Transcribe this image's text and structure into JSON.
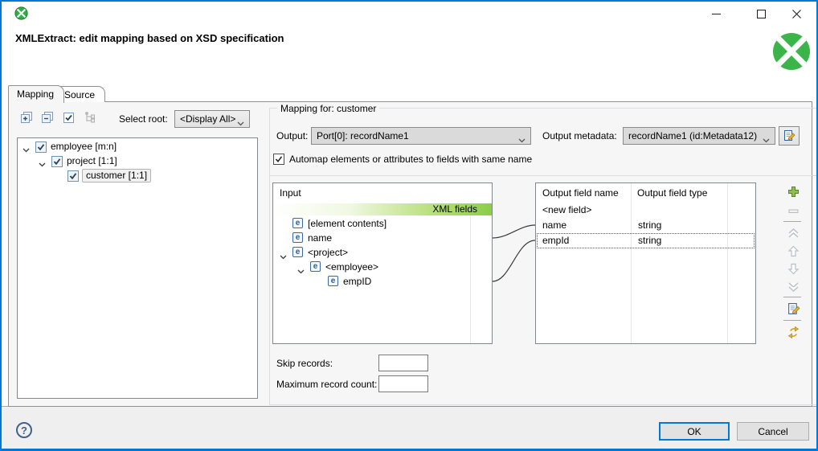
{
  "window": {
    "title": "XMLExtract: edit mapping based on XSD specification"
  },
  "tabs": [
    {
      "label": "Mapping"
    },
    {
      "label": "Source"
    }
  ],
  "left": {
    "select_root_label": "Select root:",
    "select_root_value": "<Display All>",
    "tree": [
      {
        "label": "employee [m:n]",
        "checked": true,
        "expanded": true
      },
      {
        "label": "project [1:1]",
        "checked": true,
        "expanded": true
      },
      {
        "label": "customer [1:1]",
        "checked": true,
        "selected": true
      }
    ]
  },
  "group": {
    "legend": "Mapping for: customer",
    "output_label": "Output:",
    "output_value": "Port[0]: recordName1",
    "metadata_label": "Output metadata:",
    "metadata_value": "recordName1 (id:Metadata12)",
    "automap_label": "Automap elements or attributes to fields with same name",
    "automap_checked": true
  },
  "input_panel": {
    "header": "Input",
    "subheader": "XML fields",
    "items": [
      {
        "label": "[element contents]"
      },
      {
        "label": "name"
      },
      {
        "label": "<project>"
      },
      {
        "label": "<employee>"
      },
      {
        "label": "empID"
      }
    ]
  },
  "output_table": {
    "columns": [
      "Output field name",
      "Output field type"
    ],
    "rows": [
      {
        "name": "<new field>",
        "type": ""
      },
      {
        "name": "name",
        "type": "string"
      },
      {
        "name": "empId",
        "type": "string",
        "selected": true
      }
    ]
  },
  "records": {
    "skip_label": "Skip records:",
    "skip_value": "",
    "max_label": "Maximum record count:",
    "max_value": ""
  },
  "footer": {
    "help": "?",
    "ok": "OK",
    "cancel": "Cancel"
  },
  "colors": {
    "accent_blue": "#0078d7",
    "clover_green": "#3bb54a",
    "xml_fields_green": "#8ccd4a"
  }
}
